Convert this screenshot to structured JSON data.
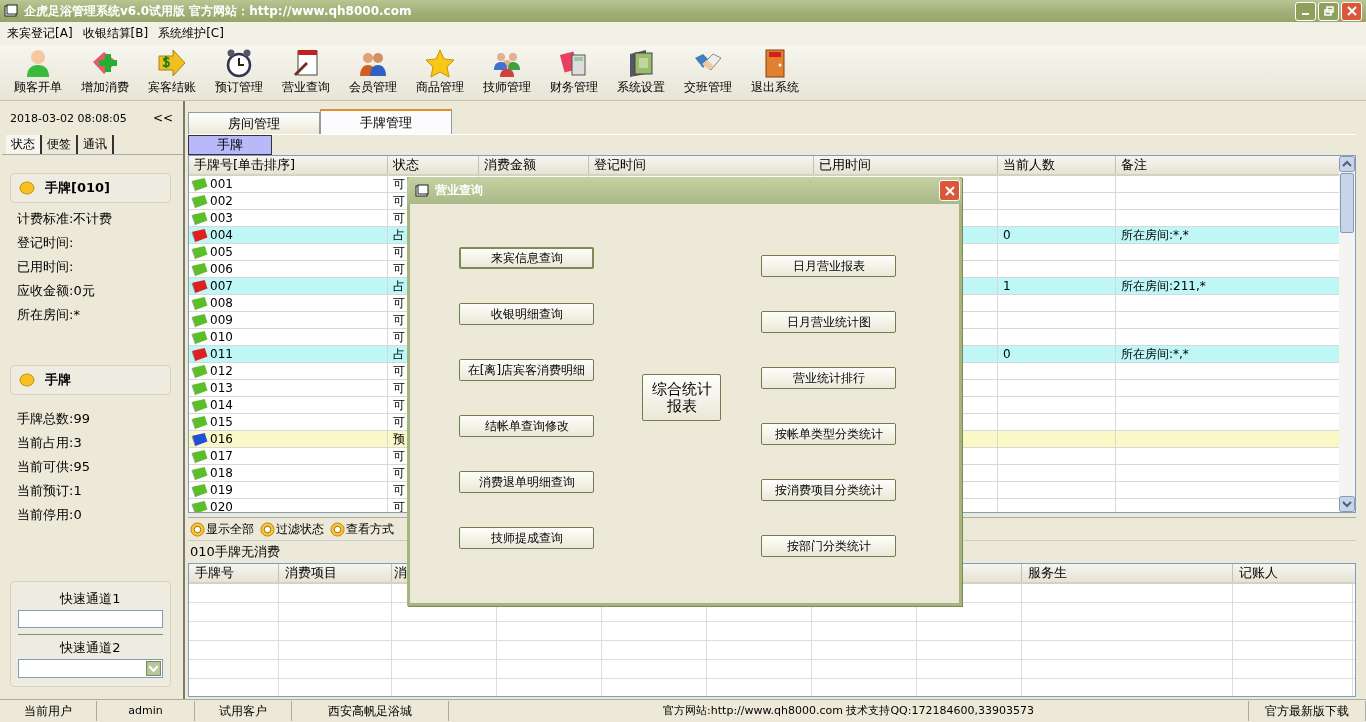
{
  "window": {
    "title": "企虎足浴管理系统v6.0试用版 官方网站：http://www.qh8000.com"
  },
  "menu": [
    "来宾登记[A]",
    "收银结算[B]",
    "系统维护[C]"
  ],
  "toolbar": [
    "顾客开单",
    "增加消费",
    "宾客结账",
    "预订管理",
    "营业查询",
    "会员管理",
    "商品管理",
    "技师管理",
    "财务管理",
    "系统设置",
    "交班管理",
    "退出系统"
  ],
  "sidebar": {
    "datetime": "2018-03-02 08:08:05",
    "collapse": "<<",
    "tabs": [
      {
        "label": "状态",
        "selected": true
      },
      {
        "label": "便签",
        "selected": false
      },
      {
        "label": "通讯",
        "selected": false
      }
    ],
    "card_title": "手牌[010]",
    "card_lines": [
      "计费标准:不计费",
      "登记时间:",
      "已用时间:",
      "应收金额:0元",
      "所在房间:*"
    ],
    "summary_title": "手牌",
    "summary_lines": [
      "手牌总数:99",
      "当前占用:3",
      "当前可供:95",
      "当前预订:1",
      "当前停用:0"
    ],
    "quick": [
      {
        "label": "快速通道1",
        "kind": "text"
      },
      {
        "label": "快速通道2",
        "kind": "select"
      }
    ]
  },
  "tabs": [
    {
      "label": "房间管理",
      "selected": false
    },
    {
      "label": "手牌管理",
      "selected": true
    }
  ],
  "subtabs": [
    {
      "label": "手牌",
      "selected": true
    }
  ],
  "table": {
    "columns": [
      "手牌号[单击排序]",
      "状态",
      "消费金额",
      "登记时间",
      "已用时间",
      "当前人数",
      "备注"
    ],
    "rows": [
      {
        "id": "001",
        "kind": "free",
        "status": "可"
      },
      {
        "id": "002",
        "kind": "free",
        "status": "可"
      },
      {
        "id": "003",
        "kind": "free",
        "status": "可"
      },
      {
        "id": "004",
        "kind": "occupied",
        "status": "占",
        "count": "0",
        "note": "所在房间:*,*"
      },
      {
        "id": "005",
        "kind": "free",
        "status": "可"
      },
      {
        "id": "006",
        "kind": "free",
        "status": "可"
      },
      {
        "id": "007",
        "kind": "occupied",
        "status": "占",
        "count": "1",
        "note": "所在房间:211,*"
      },
      {
        "id": "008",
        "kind": "free",
        "status": "可"
      },
      {
        "id": "009",
        "kind": "free",
        "status": "可"
      },
      {
        "id": "010",
        "kind": "free",
        "status": "可"
      },
      {
        "id": "011",
        "kind": "occupied",
        "status": "占",
        "count": "0",
        "note": "所在房间:*,*"
      },
      {
        "id": "012",
        "kind": "free",
        "status": "可"
      },
      {
        "id": "013",
        "kind": "free",
        "status": "可"
      },
      {
        "id": "014",
        "kind": "free",
        "status": "可"
      },
      {
        "id": "015",
        "kind": "free",
        "status": "可"
      },
      {
        "id": "016",
        "kind": "reserved",
        "status": "预"
      },
      {
        "id": "017",
        "kind": "free",
        "status": "可"
      },
      {
        "id": "018",
        "kind": "free",
        "status": "可"
      },
      {
        "id": "019",
        "kind": "free",
        "status": "可"
      },
      {
        "id": "020",
        "kind": "free",
        "status": "可"
      }
    ]
  },
  "filters": [
    "显示全部",
    "过滤状态",
    "查看方式"
  ],
  "message": "010手牌无消费",
  "detail_table": {
    "columns": [
      "手牌号",
      "消费项目",
      "消",
      "服务生",
      "记账人"
    ]
  },
  "dialog": {
    "title": "营业查询",
    "left_buttons": [
      "来宾信息查询",
      "收银明细查询",
      "在[离]店宾客消费明细",
      "结帐单查询修改",
      "消费退单明细查询",
      "技师提成查询"
    ],
    "center_button": "综合统计报表",
    "right_buttons": [
      "日月营业报表",
      "日月营业统计图",
      "营业统计排行",
      "按帐单类型分类统计",
      "按消费项目分类统计",
      "按部门分类统计"
    ]
  },
  "status_bar": [
    "当前用户",
    "admin",
    "试用客户",
    "西安高帆足浴城",
    "官方网站:http://www.qh8000.com 技术支持QQ:172184600,33903573",
    "官方最新版下载"
  ]
}
